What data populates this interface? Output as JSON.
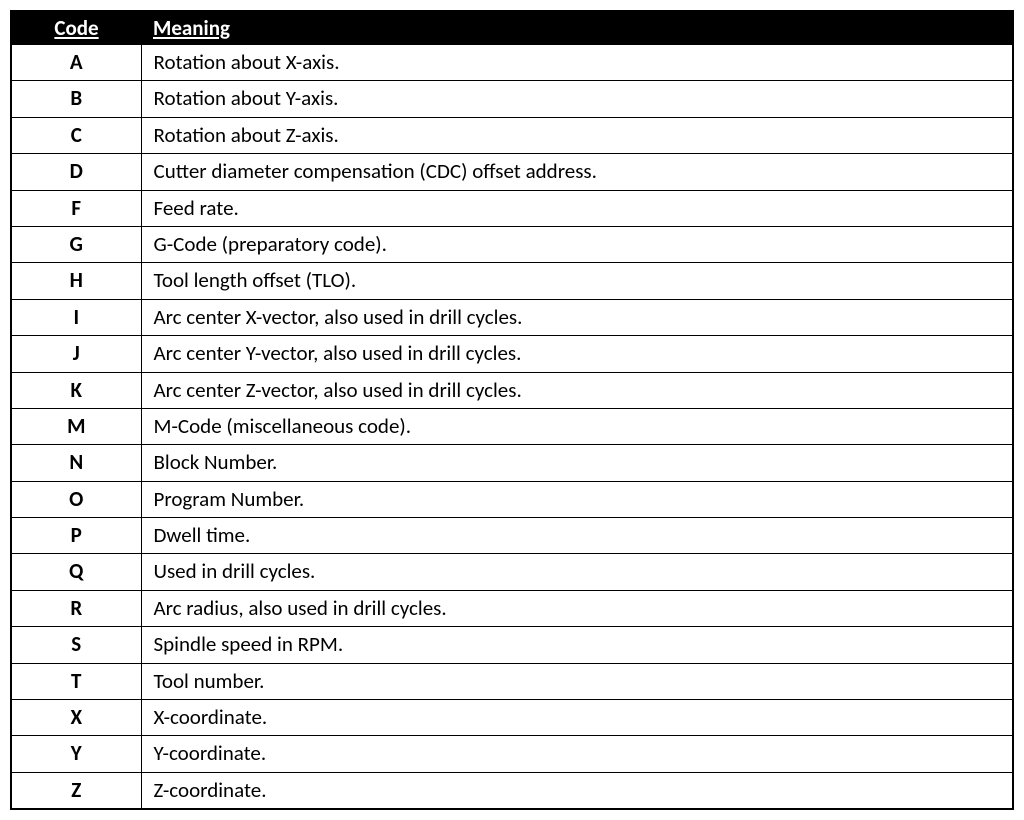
{
  "table": {
    "headers": {
      "code": "Code",
      "meaning": "Meaning"
    },
    "rows": [
      {
        "code": "A",
        "meaning": "Rotation about X-axis."
      },
      {
        "code": "B",
        "meaning": "Rotation about Y-axis."
      },
      {
        "code": "C",
        "meaning": "Rotation about Z-axis."
      },
      {
        "code": "D",
        "meaning": "Cutter diameter compensation (CDC) offset address."
      },
      {
        "code": "F",
        "meaning": "Feed rate."
      },
      {
        "code": "G",
        "meaning": "G-Code (preparatory code)."
      },
      {
        "code": "H",
        "meaning": "Tool length offset (TLO)."
      },
      {
        "code": "I",
        "meaning": "Arc center X-vector, also used in drill cycles."
      },
      {
        "code": "J",
        "meaning": "Arc center Y-vector, also used in drill cycles."
      },
      {
        "code": "K",
        "meaning": "Arc center Z-vector, also used in drill cycles."
      },
      {
        "code": "M",
        "meaning": "M-Code (miscellaneous code)."
      },
      {
        "code": "N",
        "meaning": "Block Number."
      },
      {
        "code": "O",
        "meaning": "Program Number."
      },
      {
        "code": "P",
        "meaning": "Dwell time."
      },
      {
        "code": "Q",
        "meaning": "Used in drill cycles."
      },
      {
        "code": "R",
        "meaning": "Arc radius, also used in drill cycles."
      },
      {
        "code": "S",
        "meaning": "Spindle speed in RPM."
      },
      {
        "code": "T",
        "meaning": "Tool number."
      },
      {
        "code": "X",
        "meaning": "X-coordinate."
      },
      {
        "code": "Y",
        "meaning": "Y-coordinate."
      },
      {
        "code": "Z",
        "meaning": "Z-coordinate."
      }
    ]
  }
}
